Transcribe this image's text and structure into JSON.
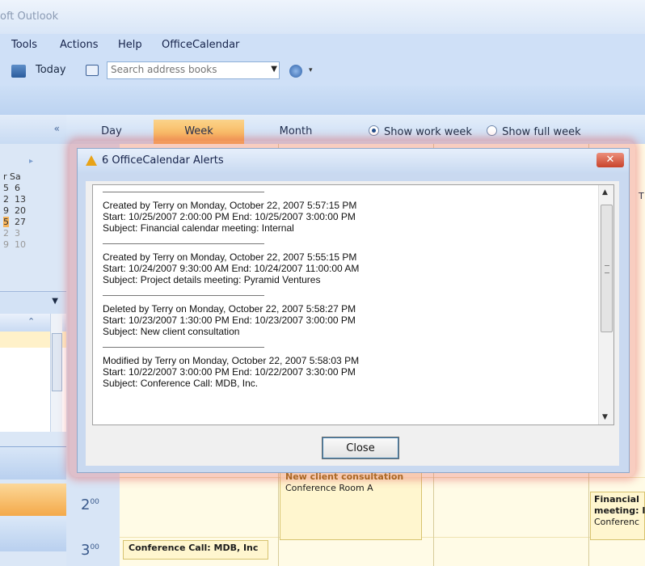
{
  "app": {
    "title_fragment": "oft Outlook"
  },
  "menu": {
    "items": [
      "Tools",
      "Actions",
      "Help",
      "OfficeCalendar"
    ]
  },
  "toolbar": {
    "today_label": "Today",
    "search_placeholder": "Search address books"
  },
  "view": {
    "tabs": [
      {
        "label": "Day"
      },
      {
        "label": "Week",
        "active": true
      },
      {
        "label": "Month"
      }
    ],
    "show_work_week": "Show work week",
    "show_full_week": "Show full week",
    "selected_mode": "work week"
  },
  "minical": {
    "header": "r Sa",
    "rows": [
      {
        "a": "5",
        "b": "6"
      },
      {
        "a": "2",
        "b": "13"
      },
      {
        "a": "9",
        "b": "20"
      },
      {
        "a": "5",
        "b": "27",
        "today": true
      },
      {
        "a": "2",
        "b": "3",
        "faded": true
      },
      {
        "a": "9",
        "b": "10",
        "faded": true
      }
    ]
  },
  "calendar": {
    "times": [
      {
        "hour": "2",
        "min": "00"
      },
      {
        "hour": "3",
        "min": "00"
      }
    ],
    "appointments": [
      {
        "title": "New client consultation",
        "location": "Conference Room A"
      },
      {
        "title": "Conference Call: MDB, Inc",
        "location": ""
      },
      {
        "title": "Financial",
        "line2": "meeting: I",
        "location": "Conferenc"
      }
    ]
  },
  "dialog": {
    "title": "6 OfficeCalendar Alerts",
    "close_label": "Close",
    "alerts": [
      {
        "line1": "Created by Terry on Monday, October 22, 2007 5:57:15 PM",
        "line2": "Start: 10/25/2007 2:00:00 PM End: 10/25/2007 3:00:00 PM",
        "line3": "Subject: Financial calendar meeting: Internal"
      },
      {
        "line1": "Created by Terry on Monday, October 22, 2007 5:55:15 PM",
        "line2": "Start: 10/24/2007 9:30:00 AM End: 10/24/2007 11:00:00 AM",
        "line3": "Subject: Project details meeting: Pyramid Ventures"
      },
      {
        "line1": "Deleted by Terry on Monday, October 22, 2007 5:58:27 PM",
        "line2": "Start: 10/23/2007 1:30:00 PM End: 10/23/2007 3:00:00 PM",
        "line3": "Subject: New client consultation"
      },
      {
        "line1": "Modified by Terry on Monday, October 22, 2007 5:58:03 PM",
        "line2": "Start: 10/22/2007 3:00:00 PM End: 10/22/2007 3:30:00 PM",
        "line3": "Subject: Conference Call: MDB, Inc."
      }
    ]
  }
}
